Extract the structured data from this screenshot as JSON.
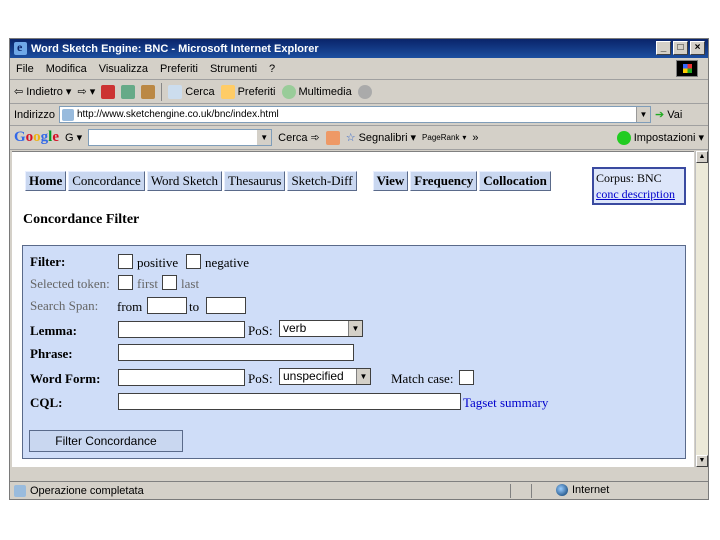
{
  "window": {
    "title": "Word Sketch Engine: BNC - Microsoft Internet Explorer",
    "controls": [
      "_",
      "□",
      "×"
    ]
  },
  "menu": [
    "File",
    "Modifica",
    "Visualizza",
    "Preferiti",
    "Strumenti",
    "?"
  ],
  "toolbar": {
    "back": "Indietro",
    "search": "Cerca",
    "favorites": "Preferiti",
    "multimedia": "Multimedia"
  },
  "address": {
    "label": "Indirizzo",
    "url": "http://www.sketchengine.co.uk/bnc/index.html",
    "go": "Vai"
  },
  "google": {
    "logo": "Google",
    "search_btn": "Cerca",
    "blocked": "Segnalibri",
    "pagerank": "PageRank",
    "settings": "Impostazioni"
  },
  "nav": {
    "left": [
      "Home",
      "Concordance",
      "Word Sketch",
      "Thesaurus",
      "Sketch-Diff"
    ],
    "right": [
      "View",
      "Frequency",
      "Collocation"
    ]
  },
  "corpus": {
    "label": "Corpus: BNC",
    "link": "conc description"
  },
  "page_title": "Concordance Filter",
  "form": {
    "filter_label": "Filter:",
    "positive": "positive",
    "negative": "negative",
    "selected_token_label": "Selected token:",
    "first": "first",
    "last": "last",
    "search_span_label": "Search Span:",
    "from": "from",
    "to": "to",
    "lemma_label": "Lemma:",
    "pos_label": "PoS:",
    "lemma_pos_value": "verb",
    "phrase_label": "Phrase:",
    "wordform_label": "Word Form:",
    "wordform_pos_value": "unspecified",
    "match_case_label": "Match case:",
    "cql_label": "CQL:",
    "tagset_link": "Tagset summary",
    "submit": "Filter Concordance"
  },
  "status": {
    "text": "Operazione completata",
    "zone": "Internet"
  }
}
